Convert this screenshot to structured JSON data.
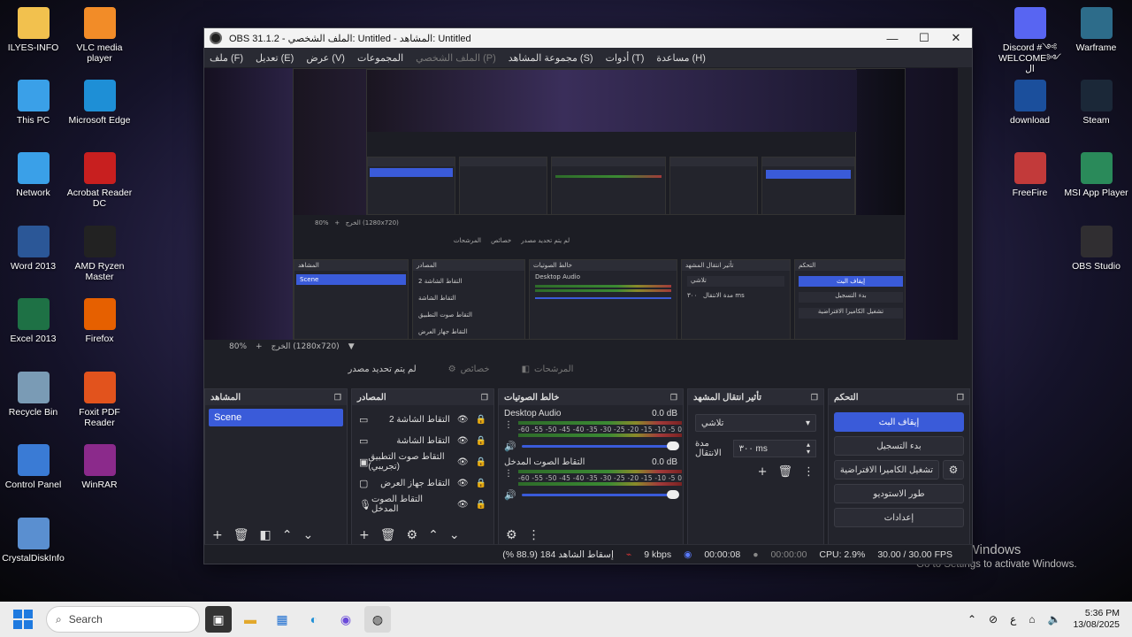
{
  "desktop": {
    "icons_left": [
      {
        "label": "ILYES-INFO",
        "icon": "folder-icon",
        "color": "#f2c14e"
      },
      {
        "label": "VLC media player",
        "icon": "vlc-icon",
        "color": "#f28c28"
      },
      {
        "label": "This PC",
        "icon": "computer-icon",
        "color": "#3aa0e8"
      },
      {
        "label": "Microsoft Edge",
        "icon": "edge-icon",
        "color": "#1e8fd6"
      },
      {
        "label": "Network",
        "icon": "network-icon",
        "color": "#3aa0e8"
      },
      {
        "label": "Acrobat Reader DC",
        "icon": "acrobat-icon",
        "color": "#c81f1f"
      },
      {
        "label": "Word 2013",
        "icon": "word-icon",
        "color": "#2b5797"
      },
      {
        "label": "AMD Ryzen Master",
        "icon": "ryzen-icon",
        "color": "#222222"
      },
      {
        "label": "Excel 2013",
        "icon": "excel-icon",
        "color": "#1e7145"
      },
      {
        "label": "Firefox",
        "icon": "firefox-icon",
        "color": "#e66000"
      },
      {
        "label": "Recycle Bin",
        "icon": "recycle-bin-icon",
        "color": "#7a9bb5"
      },
      {
        "label": "Foxit PDF Reader",
        "icon": "foxit-icon",
        "color": "#e2531d"
      },
      {
        "label": "Control Panel",
        "icon": "control-panel-icon",
        "color": "#3a7bd5"
      },
      {
        "label": "WinRAR",
        "icon": "winrar-icon",
        "color": "#8b2a8b"
      },
      {
        "label": "CrystalDiskInfo",
        "icon": "crystaldisk-icon",
        "color": "#5a8fd0"
      }
    ],
    "icons_right": [
      {
        "label": "Discord #༺ WELCOME༻ ال",
        "icon": "discord-icon",
        "color": "#5865f2"
      },
      {
        "label": "Warframe",
        "icon": "warframe-icon",
        "color": "#2d6c8a"
      },
      {
        "label": "download",
        "icon": "download-icon",
        "color": "#1b4f9c"
      },
      {
        "label": "Steam",
        "icon": "steam-icon",
        "color": "#1b2838"
      },
      {
        "label": "FreeFire",
        "icon": "freefire-icon",
        "color": "#c23a3a"
      },
      {
        "label": "MSI App Player",
        "icon": "msi-icon",
        "color": "#2a8a5a"
      },
      {
        "label": "OBS Studio",
        "icon": "obs-icon",
        "color": "#302e31"
      }
    ]
  },
  "window": {
    "title": "OBS 31.1.2 - الملف الشخصي: Untitled - المشاهد: Untitled",
    "controls": {
      "minimize": "—",
      "maximize": "☐",
      "close": "✕"
    }
  },
  "menu": [
    {
      "label": "ملف (F)",
      "enabled": true
    },
    {
      "label": "تعديل (E)",
      "enabled": true
    },
    {
      "label": "عرض (V)",
      "enabled": true
    },
    {
      "label": "المجموعات",
      "enabled": true
    },
    {
      "label": "الملف الشخصي (P)",
      "enabled": false
    },
    {
      "label": "مجموعة المشاهد (S)",
      "enabled": true
    },
    {
      "label": "أدوات (T)",
      "enabled": true
    },
    {
      "label": "مساعدة (H)",
      "enabled": true
    }
  ],
  "preview": {
    "zoom": "80%",
    "plus": "+",
    "output_label": "الخرج (1280x720)"
  },
  "tabs": {
    "no_source": "لم يتم تحديد مصدر",
    "properties": "خصائص",
    "filters": "المرشحات"
  },
  "scenes_dock": {
    "title": "المشاهد",
    "items": [
      "Scene"
    ]
  },
  "sources_dock": {
    "title": "المصادر",
    "items": [
      {
        "label": "التقاط الشاشة 2",
        "icon": "display-capture-icon"
      },
      {
        "label": "التقاط الشاشة",
        "icon": "display-capture-icon"
      },
      {
        "label": "التقاط صوت التطبيق (تجريبي)",
        "icon": "app-audio-icon"
      },
      {
        "label": "التقاط جهاز العرض",
        "icon": "monitor-icon"
      },
      {
        "label": "التقاط الصوت المدخل",
        "icon": "mic-icon"
      }
    ]
  },
  "mixer_dock": {
    "title": "خالط الصوتيات",
    "scale": "-60 -55 -50 -45 -40 -35 -30 -25 -20 -15 -10 -5 0",
    "channels": [
      {
        "name": "Desktop Audio",
        "db": "0.0 dB",
        "volume": 1.0
      },
      {
        "name": "التقاط الصوت المدخل",
        "db": "0.0 dB",
        "volume": 1.0
      }
    ]
  },
  "transitions_dock": {
    "title": "تأثير انتقال المشهد",
    "selected": "تلاشي",
    "duration_label": "مدة الانتقال",
    "duration_value": "٣٠٠ ms"
  },
  "controls_dock": {
    "title": "التحكم",
    "buttons": [
      "إيقاف البث",
      "بدء التسجيل",
      "تشغيل الكاميرا الافتراضية",
      "طور الاستوديو",
      "إعدادات"
    ]
  },
  "status": {
    "dropped_frames": "إسقاط الشاهد 184 (88.9 %)",
    "bitrate": "9 kbps",
    "stream_time": "00:00:08",
    "record_time": "00:00:00",
    "cpu": "CPU: 2.9%",
    "fps": "30.00 / 30.00 FPS"
  },
  "activation": {
    "line1": "Activate Windows",
    "line2": "Go to Settings to activate Windows."
  },
  "taskbar": {
    "search_placeholder": "Search",
    "clock_time": "5:36 PM",
    "clock_date": "13/08/2025",
    "lang": "ع"
  },
  "colors": {
    "accent": "#3a5bd9",
    "window_bg": "#1e1f26",
    "dock_bg": "#23242c"
  }
}
